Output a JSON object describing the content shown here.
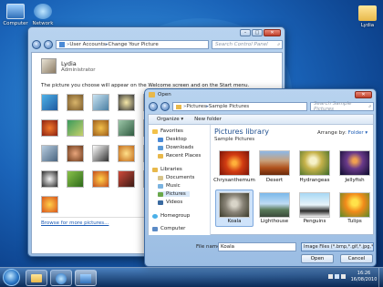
{
  "desktop": {
    "icons": [
      {
        "label": "Computer"
      },
      {
        "label": "Network"
      },
      {
        "label": "Lydia"
      }
    ]
  },
  "control_panel": {
    "breadcrumb": [
      "User Accounts",
      "Change Your Picture"
    ],
    "search_placeholder": "Search Control Panel",
    "user_name": "Lydia",
    "user_role": "Administrator",
    "instructions": "The picture you choose will appear on the Welcome screen and on the Start menu.",
    "browse_link": "Browse for more pictures..."
  },
  "open_dialog": {
    "title": "Open",
    "breadcrumb": [
      "Pictures",
      "Sample Pictures"
    ],
    "search_placeholder": "Search Sample Pictures",
    "toolbar": {
      "organize": "Organize ▾",
      "new_folder": "New folder"
    },
    "nav": {
      "favorites_header": "Favorites",
      "favorites": [
        "Desktop",
        "Downloads",
        "Recent Places"
      ],
      "libraries_header": "Libraries",
      "libraries": [
        "Documents",
        "Music",
        "Pictures",
        "Videos"
      ],
      "homegroup": "Homegroup",
      "computer": "Computer"
    },
    "library_title": "Pictures library",
    "library_subtitle": "Sample Pictures",
    "arrange_label": "Arrange by:",
    "arrange_value": "Folder ▾",
    "files": [
      "Chrysanthemum",
      "Desert",
      "Hydrangeas",
      "Jellyfish",
      "Koala",
      "Lighthouse",
      "Penguins",
      "Tulips"
    ],
    "selected_file": "Koala",
    "file_name_label": "File name:",
    "file_name_value": "Koala",
    "file_type_value": "Image Files (*.bmp,*.gif,*.jpg,*",
    "open_button": "Open",
    "cancel_button": "Cancel"
  },
  "taskbar": {
    "time": "16:26",
    "date": "16/08/2010"
  }
}
